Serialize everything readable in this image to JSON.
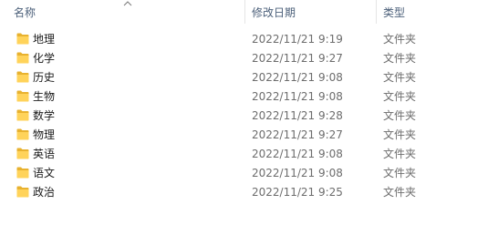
{
  "columns": {
    "name": "名称",
    "date_modified": "修改日期",
    "type": "类型"
  },
  "sort": {
    "column": "name",
    "direction": "ascending",
    "icon": "sort-up-icon"
  },
  "colors": {
    "folder_front": "#ffd35a",
    "folder_back": "#e8b22f",
    "header_text": "#4c607a",
    "secondary_text": "#6d6d6d"
  },
  "files": [
    {
      "name": "地理",
      "date": "2022/11/21 9:19",
      "type": "文件夹",
      "icon": "folder-icon"
    },
    {
      "name": "化学",
      "date": "2022/11/21 9:27",
      "type": "文件夹",
      "icon": "folder-icon"
    },
    {
      "name": "历史",
      "date": "2022/11/21 9:08",
      "type": "文件夹",
      "icon": "folder-icon"
    },
    {
      "name": "生物",
      "date": "2022/11/21 9:08",
      "type": "文件夹",
      "icon": "folder-icon"
    },
    {
      "name": "数学",
      "date": "2022/11/21 9:28",
      "type": "文件夹",
      "icon": "folder-icon"
    },
    {
      "name": "物理",
      "date": "2022/11/21 9:27",
      "type": "文件夹",
      "icon": "folder-icon"
    },
    {
      "name": "英语",
      "date": "2022/11/21 9:08",
      "type": "文件夹",
      "icon": "folder-icon"
    },
    {
      "name": "语文",
      "date": "2022/11/21 9:08",
      "type": "文件夹",
      "icon": "folder-icon"
    },
    {
      "name": "政治",
      "date": "2022/11/21 9:25",
      "type": "文件夹",
      "icon": "folder-icon"
    }
  ]
}
